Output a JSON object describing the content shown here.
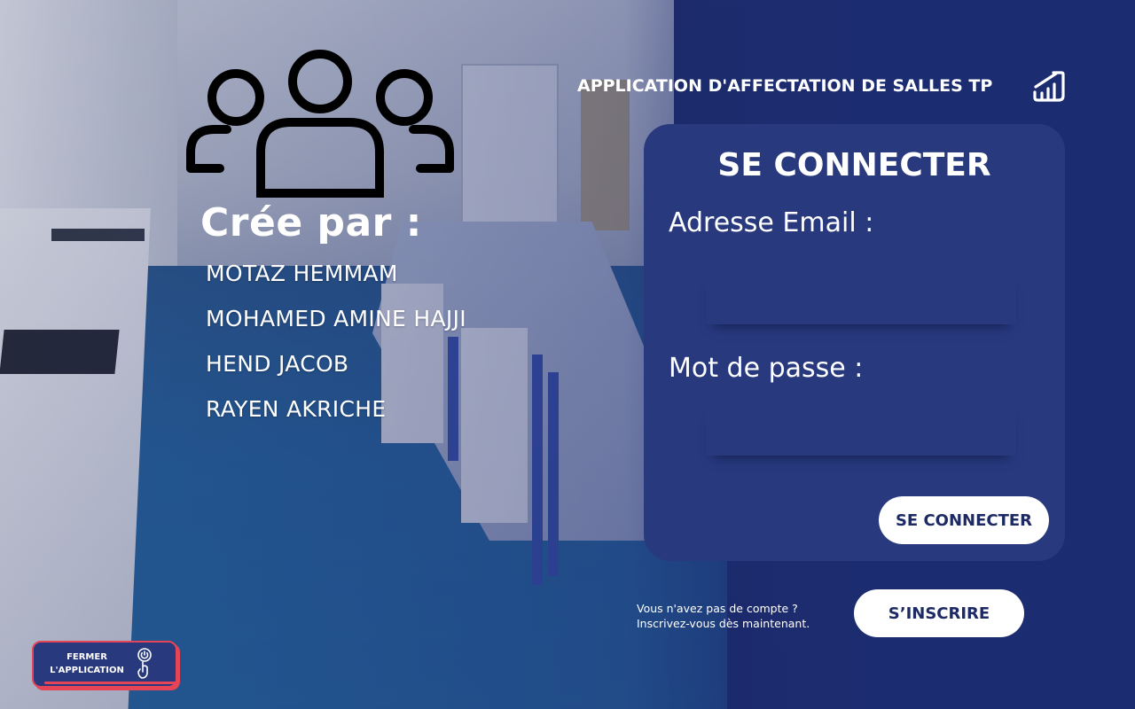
{
  "app": {
    "title": "APPLICATION D'AFFECTATION DE SALLES TP",
    "logo_icon": "chart-growth-icon"
  },
  "credits": {
    "icon": "users-group-icon",
    "title": "Crée par :",
    "authors": [
      "MOTAZ HEMMAM",
      "MOHAMED AMINE HAJJI",
      "HEND JACOB",
      "RAYEN AKRICHE"
    ]
  },
  "login": {
    "title": "SE CONNECTER",
    "email_label": "Adresse Email :",
    "email_value": "",
    "password_label": "Mot de passe :",
    "password_value": "",
    "submit_label": "SE CONNECTER"
  },
  "signup": {
    "prompt_line1": "Vous n'avez pas de compte ?",
    "prompt_line2": "Inscrivez-vous dès maintenant.",
    "button_label": "S’INSCRIRE"
  },
  "close_app": {
    "line1": "FERMER",
    "line2": "L'APPLICATION",
    "icon": "touch-power-icon"
  },
  "colors": {
    "panel": "#28397e",
    "background": "#1f2f6b",
    "accent_red": "#e64457",
    "button": "#ffffff",
    "button_text": "#1d2a63"
  }
}
